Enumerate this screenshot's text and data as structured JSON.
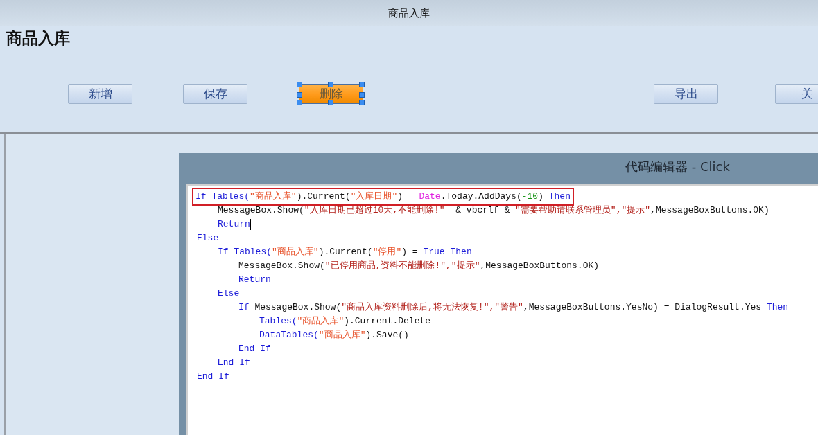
{
  "window": {
    "title": "商品入库"
  },
  "form": {
    "heading": "商品入库",
    "buttons": [
      {
        "label": "新增",
        "selected": false
      },
      {
        "label": "保存",
        "selected": false
      },
      {
        "label": "删除",
        "selected": true
      },
      {
        "label": "导出",
        "selected": false
      },
      {
        "label": "关",
        "selected": false
      }
    ]
  },
  "code_editor": {
    "title": "代码编辑器 - Click",
    "lines": [
      {
        "highlighted": true,
        "caret": false,
        "tokens": [
          {
            "kind": "keyword",
            "text": "If Tables("
          },
          {
            "kind": "string",
            "text": "\"商品入库\""
          },
          {
            "kind": "plain",
            "text": ").Current("
          },
          {
            "kind": "string",
            "text": "\"入库日期\""
          },
          {
            "kind": "plain",
            "text": ") = "
          },
          {
            "kind": "type",
            "text": "Date"
          },
          {
            "kind": "plain",
            "text": ".Today.AddDays("
          },
          {
            "kind": "number",
            "text": "-10"
          },
          {
            "kind": "plain",
            "text": ") "
          },
          {
            "kind": "keyword",
            "text": "Then"
          }
        ],
        "children": [
          {
            "highlighted": false,
            "caret": false,
            "tokens": [
              {
                "kind": "plain",
                "text": "MessageBox.Show("
              },
              {
                "kind": "message",
                "text": "\"入库日期已超过10天,不能删除!\""
              },
              {
                "kind": "plain",
                "text": "  & vbcrlf & "
              },
              {
                "kind": "message",
                "text": "\"需要帮助请联系管理员\",\"提示\""
              },
              {
                "kind": "plain",
                "text": ",MessageBoxButtons.OK)"
              }
            ]
          },
          {
            "highlighted": false,
            "caret": true,
            "tokens": [
              {
                "kind": "keyword",
                "text": "Return"
              }
            ]
          }
        ]
      },
      {
        "highlighted": false,
        "caret": false,
        "tokens": [
          {
            "kind": "keyword",
            "text": "Else"
          }
        ],
        "children": [
          {
            "highlighted": false,
            "caret": false,
            "tokens": [
              {
                "kind": "keyword",
                "text": "If Tables("
              },
              {
                "kind": "string",
                "text": "\"商品入库\""
              },
              {
                "kind": "plain",
                "text": ").Current("
              },
              {
                "kind": "string",
                "text": "\"停用\""
              },
              {
                "kind": "plain",
                "text": ") = "
              },
              {
                "kind": "keyword",
                "text": "True Then"
              }
            ],
            "children": [
              {
                "highlighted": false,
                "caret": false,
                "tokens": [
                  {
                    "kind": "plain",
                    "text": "MessageBox.Show("
                  },
                  {
                    "kind": "message",
                    "text": "\"已停用商品,资料不能删除!\",\"提示\""
                  },
                  {
                    "kind": "plain",
                    "text": ",MessageBoxButtons.OK)"
                  }
                ]
              },
              {
                "highlighted": false,
                "caret": false,
                "tokens": [
                  {
                    "kind": "keyword",
                    "text": "Return"
                  }
                ]
              }
            ]
          },
          {
            "highlighted": false,
            "caret": false,
            "tokens": [
              {
                "kind": "keyword",
                "text": "Else"
              }
            ],
            "children": [
              {
                "highlighted": false,
                "caret": false,
                "tokens": [
                  {
                    "kind": "keyword",
                    "text": "If "
                  },
                  {
                    "kind": "plain",
                    "text": "MessageBox.Show("
                  },
                  {
                    "kind": "message",
                    "text": "\"商品入库资料删除后,将无法恢复!\",\"警告\""
                  },
                  {
                    "kind": "plain",
                    "text": ",MessageBoxButtons.YesNo) = DialogResult.Yes "
                  },
                  {
                    "kind": "keyword",
                    "text": "Then"
                  }
                ],
                "children": [
                  {
                    "highlighted": false,
                    "caret": false,
                    "tokens": [
                      {
                        "kind": "keyword",
                        "text": "Tables("
                      },
                      {
                        "kind": "string",
                        "text": "\"商品入库\""
                      },
                      {
                        "kind": "plain",
                        "text": ").Current.Delete"
                      }
                    ]
                  },
                  {
                    "highlighted": false,
                    "caret": false,
                    "tokens": [
                      {
                        "kind": "keyword",
                        "text": "DataTables("
                      },
                      {
                        "kind": "string",
                        "text": "\"商品入库\""
                      },
                      {
                        "kind": "plain",
                        "text": ").Save()"
                      }
                    ]
                  }
                ]
              },
              {
                "highlighted": false,
                "caret": false,
                "tokens": [
                  {
                    "kind": "keyword",
                    "text": "End If"
                  }
                ]
              }
            ]
          },
          {
            "highlighted": false,
            "caret": false,
            "tokens": [
              {
                "kind": "keyword",
                "text": "End If"
              }
            ]
          }
        ]
      },
      {
        "highlighted": false,
        "caret": false,
        "tokens": [
          {
            "kind": "keyword",
            "text": "End If"
          }
        ]
      }
    ]
  }
}
